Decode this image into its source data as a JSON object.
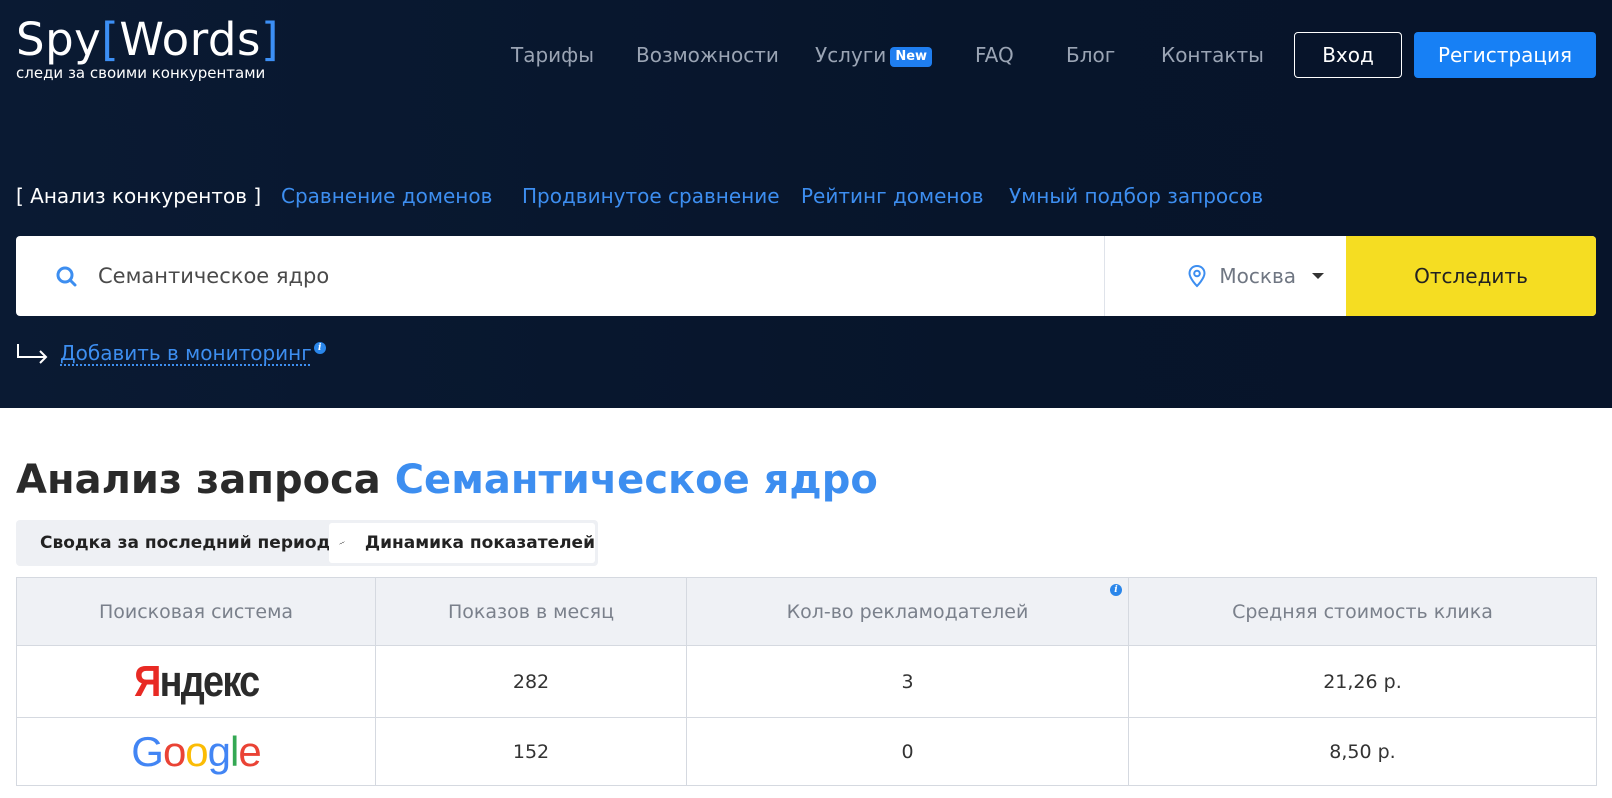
{
  "logo": {
    "name_left": "Spy",
    "bracket_open": "[",
    "name_right": "Words",
    "bracket_close": "]",
    "tagline": "следи за своими конкурентами"
  },
  "topnav": {
    "items": [
      "Тарифы",
      "Возможности",
      "Услуги",
      "FAQ",
      "Блог",
      "Контакты"
    ],
    "services_badge": "New",
    "login": "Вход",
    "register": "Регистрация"
  },
  "subnav": {
    "active": "[ Анализ конкурентов ]",
    "items": [
      "Сравнение доменов",
      "Продвинутое сравнение",
      "Рейтинг доменов",
      "Умный подбор запросов"
    ]
  },
  "search": {
    "value": "Семантическое ядро",
    "region": "Москва",
    "submit": "Отследить"
  },
  "monitoring": {
    "link": "Добавить в мониторинг",
    "info": "i"
  },
  "page": {
    "title_prefix": "Анализ запроса",
    "title_query": "Семантическое ядро"
  },
  "tabs": {
    "summary": "Сводка за последний период",
    "dynamics": "Динамика показателей"
  },
  "table": {
    "headers": [
      "Поисковая система",
      "Показов в месяц",
      "Кол-во рекламодателей",
      "Средняя стоимость клика"
    ],
    "info": "i",
    "rows": [
      {
        "engine": "Яндекс",
        "impressions": "282",
        "advertisers": "3",
        "cpc": "21,26 р."
      },
      {
        "engine": "Google",
        "impressions": "152",
        "advertisers": "0",
        "cpc": "8,50 р."
      }
    ]
  },
  "colors": {
    "hero_bg": "#07152b",
    "accent_blue": "#3d8ef0",
    "register_btn": "#1780f5",
    "track_btn": "#f5dd22"
  }
}
